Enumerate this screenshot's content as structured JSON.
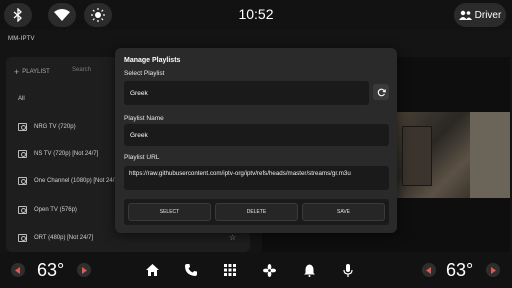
{
  "statusbar": {
    "time": "10:52",
    "icons": [
      "bluetooth-icon",
      "wifi-icon",
      "brightness-icon"
    ],
    "profile_label": "Driver"
  },
  "app": {
    "title": "MM-IPTV",
    "playlist_button": "PLAYLIST",
    "search_placeholder": "Search",
    "category_all": "All",
    "channels": [
      {
        "name": "NRG TV (720p)"
      },
      {
        "name": "NS TV (720p) [Not 24/7]"
      },
      {
        "name": "One Channel (1080p) [Not 24/7]"
      },
      {
        "name": "Open TV (576p)"
      },
      {
        "name": "ORT (480p) [Not 24/7]"
      }
    ]
  },
  "dialog": {
    "title": "Manage Playlists",
    "select_label": "Select Playlist",
    "selected_playlist": "Greek",
    "name_label": "Playlist Name",
    "name_value": "Greek",
    "url_label": "Playlist URL",
    "url_value": "https://raw.githubusercontent.com/iptv-org/iptv/refs/heads/master/streams/gr.m3u",
    "buttons": {
      "select": "SELECT",
      "delete": "DELETE",
      "save": "SAVE"
    }
  },
  "navbar": {
    "left_temp": "63°",
    "right_temp": "63°",
    "icons": [
      "home-icon",
      "phone-icon",
      "apps-grid-icon",
      "fan-icon",
      "bell-icon",
      "mic-icon"
    ]
  },
  "colors": {
    "accent_arrow": "#e05a4a",
    "background": "#141414",
    "dialog": "#2a2a2a"
  }
}
